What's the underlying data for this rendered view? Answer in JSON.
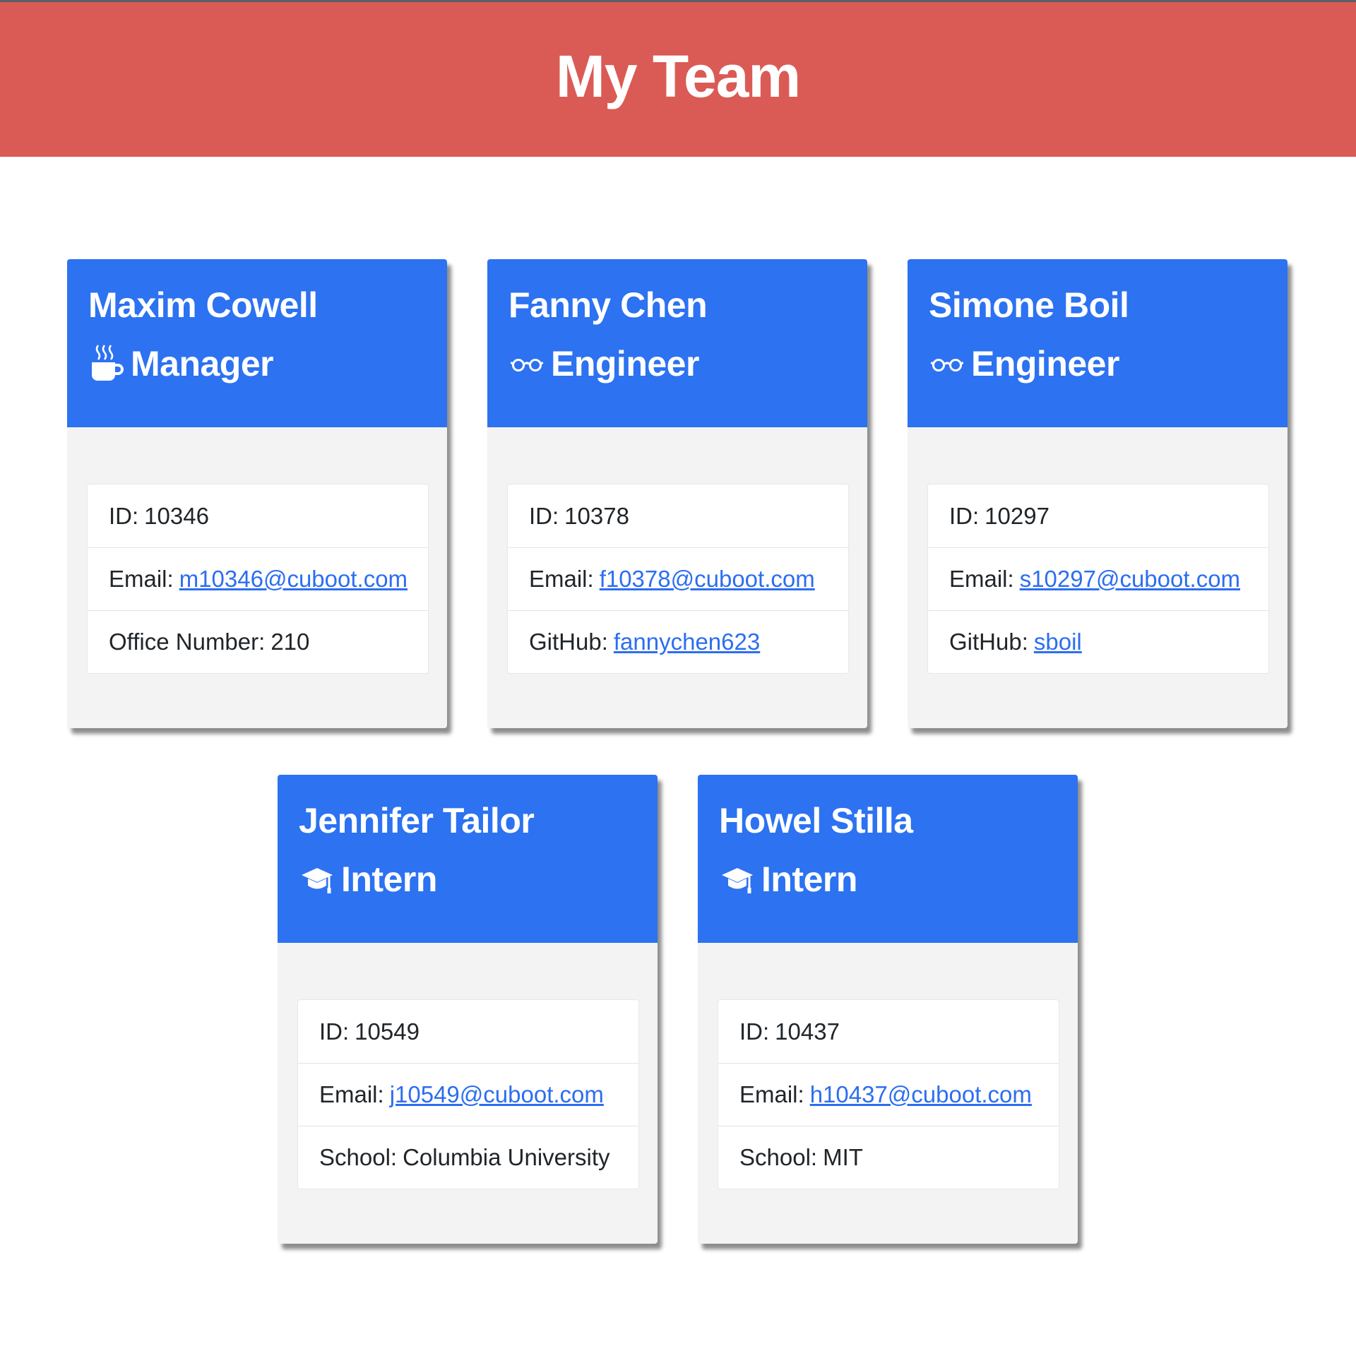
{
  "page": {
    "title": "My Team",
    "header_color": "#da5b55",
    "card_header_color": "#2c72f1",
    "link_color": "#2c6ef0"
  },
  "cards": [
    {
      "name": "Maxim Cowell",
      "role": "Manager",
      "icon": "coffee-icon",
      "id_label": "ID:",
      "id": "10346",
      "email_label": "Email:",
      "email": "m10346@cuboot.com",
      "extra_label": "Office Number:",
      "extra_value": "210"
    },
    {
      "name": "Fanny Chen",
      "role": "Engineer",
      "icon": "glasses-icon",
      "id_label": "ID:",
      "id": "10378",
      "email_label": "Email:",
      "email": "f10378@cuboot.com",
      "extra_label": "GitHub:",
      "extra_value": "fannychen623"
    },
    {
      "name": "Simone Boil",
      "role": "Engineer",
      "icon": "glasses-icon",
      "id_label": "ID:",
      "id": "10297",
      "email_label": "Email:",
      "email": "s10297@cuboot.com",
      "extra_label": "GitHub:",
      "extra_value": "sboil"
    },
    {
      "name": "Jennifer Tailor",
      "role": "Intern",
      "icon": "graduation-cap-icon",
      "id_label": "ID:",
      "id": "10549",
      "email_label": "Email:",
      "email": "j10549@cuboot.com",
      "extra_label": "School:",
      "extra_value": "Columbia University"
    },
    {
      "name": "Howel Stilla",
      "role": "Intern",
      "icon": "graduation-cap-icon",
      "id_label": "ID:",
      "id": "10437",
      "email_label": "Email:",
      "email": "h10437@cuboot.com",
      "extra_label": "School:",
      "extra_value": "MIT"
    }
  ]
}
